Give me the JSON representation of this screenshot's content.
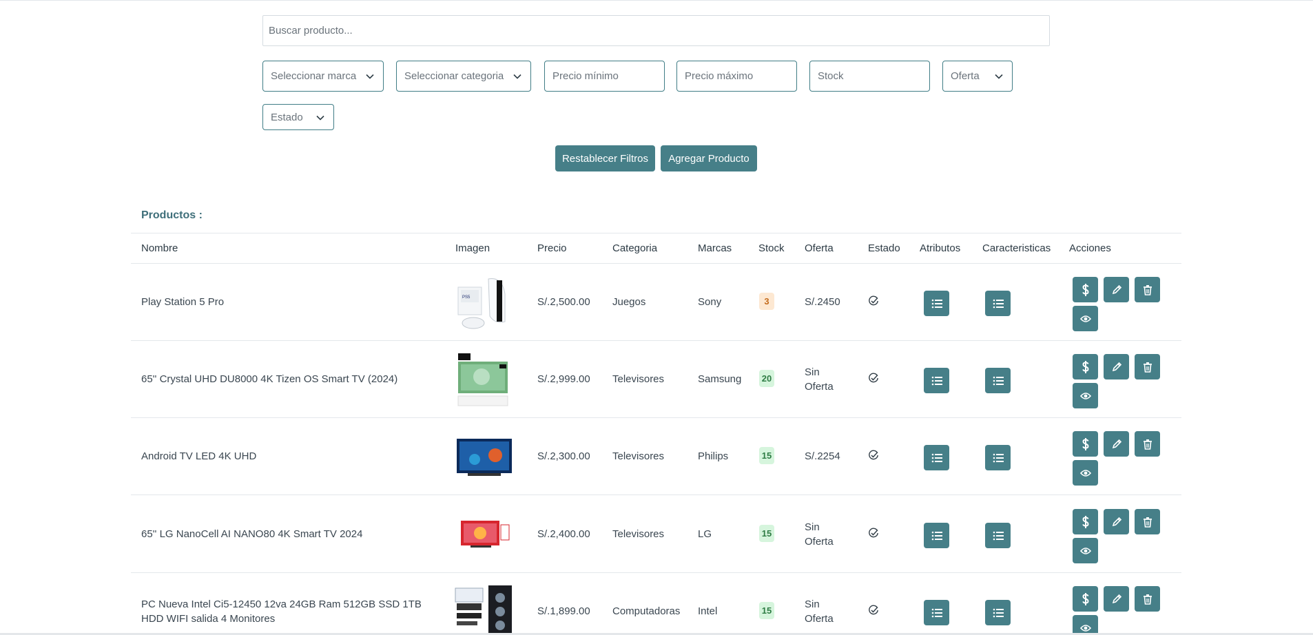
{
  "search": {
    "placeholder": "Buscar producto..."
  },
  "filters": {
    "brand": "Seleccionar marca",
    "category": "Seleccionar categoria",
    "min_price": "Precio mínimo",
    "max_price": "Precio máximo",
    "stock": "Stock",
    "offer": "Oferta",
    "status": "Estado"
  },
  "buttons": {
    "reset": "Restablecer Filtros",
    "add": "Agregar Producto"
  },
  "section_title": "Productos :",
  "columns": [
    "Nombre",
    "Imagen",
    "Precio",
    "Categoria",
    "Marcas",
    "Stock",
    "Oferta",
    "Estado",
    "Atributos",
    "Caracteristicas",
    "Acciones"
  ],
  "rows": [
    {
      "name": "Play Station 5 Pro",
      "price": "S/.2,500.00",
      "category": "Juegos",
      "brand": "Sony",
      "stock": "3",
      "stock_level": "low",
      "offer": "S/.2450"
    },
    {
      "name": "65'' Crystal UHD DU8000 4K Tizen OS Smart TV (2024)",
      "price": "S/.2,999.00",
      "category": "Televisores",
      "brand": "Samsung",
      "stock": "20",
      "stock_level": "ok",
      "offer": "Sin Oferta"
    },
    {
      "name": "Android TV LED 4K UHD",
      "price": "S/.2,300.00",
      "category": "Televisores",
      "brand": "Philips",
      "stock": "15",
      "stock_level": "ok",
      "offer": "S/.2254"
    },
    {
      "name": "65'' LG NanoCell AI NANO80 4K Smart TV 2024",
      "price": "S/.2,400.00",
      "category": "Televisores",
      "brand": "LG",
      "stock": "15",
      "stock_level": "ok",
      "offer": "Sin Oferta"
    },
    {
      "name": "PC Nueva Intel Ci5-12450 12va 24GB Ram 512GB SSD 1TB HDD WIFI salida 4 Monitores",
      "price": "S/.1,899.00",
      "category": "Computadoras",
      "brand": "Intel",
      "stock": "15",
      "stock_level": "ok",
      "offer": "Sin Oferta"
    }
  ],
  "icons": {
    "price": "dollar-icon",
    "edit": "pencil-icon",
    "delete": "trash-icon",
    "view": "eye-icon",
    "list": "list-icon",
    "status": "check-circle-icon"
  },
  "colors": {
    "accent": "#467f88",
    "stock_low_bg": "#fde8d2",
    "stock_ok_bg": "#d6f5dd"
  }
}
